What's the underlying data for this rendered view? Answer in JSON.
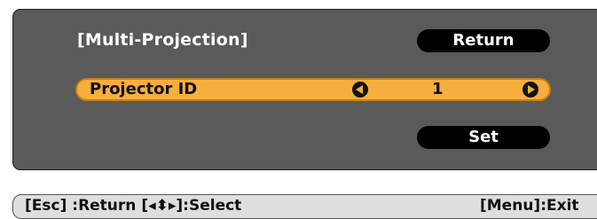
{
  "menu": {
    "title": "[Multi-Projection]",
    "return_label": "Return",
    "set_label": "Set",
    "setting": {
      "label": "Projector ID",
      "value": "1"
    }
  },
  "help_bar": {
    "left_text": "[Esc] :Return  [◂⬍▸]:Select",
    "right_text": "[Menu]:Exit"
  },
  "colors": {
    "panel_bg": "#5a5a5a",
    "highlight": "#f7ae3f",
    "button_bg": "#000000",
    "help_bg": "#dedede"
  },
  "icons": {
    "left_arrow": "left-arrow-icon",
    "right_arrow": "right-arrow-icon"
  }
}
